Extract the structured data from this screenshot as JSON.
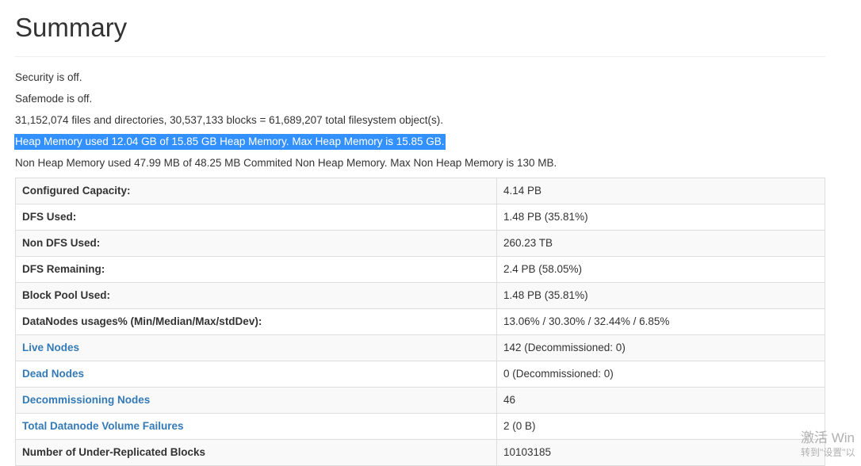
{
  "header": {
    "title": "Summary"
  },
  "status": {
    "security": "Security is off.",
    "safemode": "Safemode is off.",
    "files": "31,152,074 files and directories, 30,537,133 blocks = 61,689,207 total filesystem object(s).",
    "heap": "Heap Memory used 12.04 GB of 15.85 GB Heap Memory. Max Heap Memory is 15.85 GB.",
    "nonheap": "Non Heap Memory used 47.99 MB of 48.25 MB Commited Non Heap Memory. Max Non Heap Memory is 130 MB."
  },
  "table": {
    "rows": [
      {
        "label": "Configured Capacity:",
        "value": "4.14 PB",
        "link": false
      },
      {
        "label": "DFS Used:",
        "value": "1.48 PB (35.81%)",
        "link": false
      },
      {
        "label": "Non DFS Used:",
        "value": "260.23 TB",
        "link": false
      },
      {
        "label": "DFS Remaining:",
        "value": "2.4 PB (58.05%)",
        "link": false
      },
      {
        "label": "Block Pool Used:",
        "value": "1.48 PB (35.81%)",
        "link": false
      },
      {
        "label": "DataNodes usages% (Min/Median/Max/stdDev):",
        "value": "13.06% / 30.30% / 32.44% / 6.85%",
        "link": false
      },
      {
        "label": "Live Nodes",
        "value": "142 (Decommissioned: 0)",
        "link": true
      },
      {
        "label": "Dead Nodes",
        "value": "0 (Decommissioned: 0)",
        "link": true
      },
      {
        "label": "Decommissioning Nodes",
        "value": "46",
        "link": true
      },
      {
        "label": "Total Datanode Volume Failures",
        "value": "2 (0 B)",
        "link": true
      },
      {
        "label": "Number of Under-Replicated Blocks",
        "value": "10103185",
        "link": false
      }
    ]
  },
  "watermark": {
    "line1": "激活 Win",
    "line2": "转到\"设置\"以"
  },
  "colors": {
    "link": "#337ab7",
    "selection": "#3390ff",
    "stripe": "#f9f9f9",
    "border": "#dddddd"
  }
}
